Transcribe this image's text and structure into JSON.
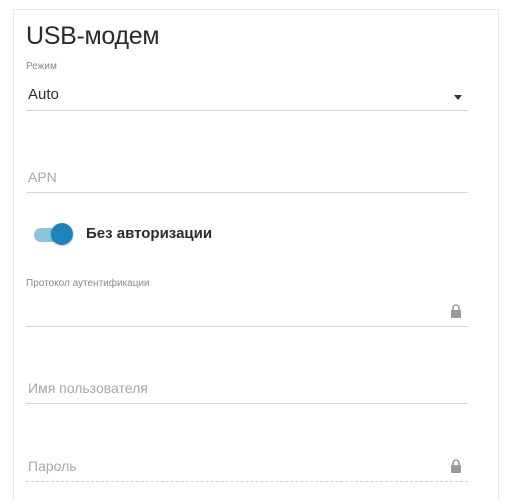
{
  "title": "USB-модем",
  "mode": {
    "label": "Режим",
    "value": "Auto"
  },
  "apn": {
    "placeholder": "APN"
  },
  "no_auth_toggle": {
    "label": "Без авторизации",
    "state": "on",
    "color": "#1d83b8"
  },
  "auth_protocol": {
    "label": "Протокол аутентификации",
    "locked": true
  },
  "username": {
    "placeholder": "Имя пользователя"
  },
  "password": {
    "placeholder": "Пароль",
    "locked": true
  },
  "icons": {
    "lock": "lock-icon",
    "dropdown": "chevron-down-icon"
  }
}
